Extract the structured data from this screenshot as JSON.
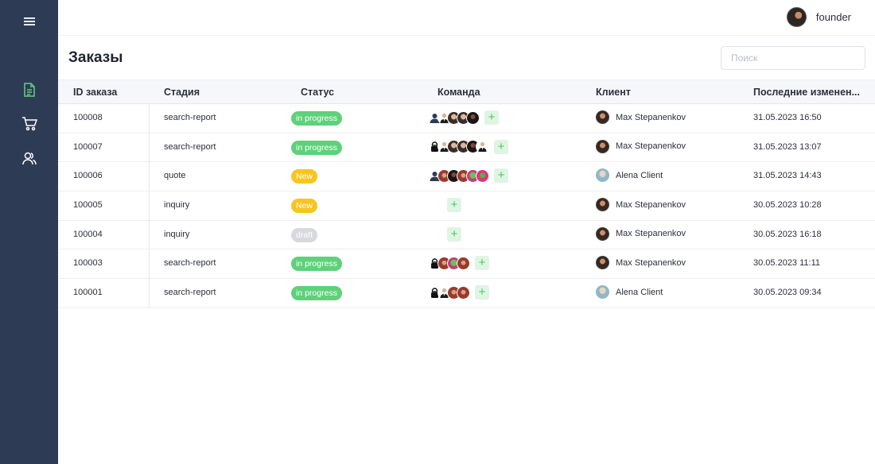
{
  "sidebar": {
    "items": [
      {
        "name": "menu",
        "icon": "hamburger-icon",
        "color": "#ffffff"
      },
      {
        "name": "orders",
        "icon": "document-icon",
        "color": "#5ed17a",
        "active": true
      },
      {
        "name": "cart",
        "icon": "cart-icon",
        "color": "#ffffff"
      },
      {
        "name": "users",
        "icon": "users-icon",
        "color": "#ffffff"
      }
    ]
  },
  "header": {
    "user_name": "founder"
  },
  "page": {
    "title": "Заказы",
    "search_placeholder": "Поиск"
  },
  "table": {
    "columns": [
      "ID заказа",
      "Стадия",
      "Статус",
      "Команда",
      "Клиент",
      "Последние изменен..."
    ],
    "add_label": "+",
    "rows": [
      {
        "id": "100008",
        "stage": "search-report",
        "status": "in progress",
        "status_color": "#5ed17a",
        "team": [
          "person-icon",
          "man-icon",
          "photo",
          "photo",
          "dark"
        ],
        "client": "Max Stepanenkov",
        "client_avatar": "max",
        "date": "31.05.2023 16:50"
      },
      {
        "id": "100007",
        "stage": "search-report",
        "status": "in progress",
        "status_color": "#5ed17a",
        "team": [
          "lock-person-icon",
          "man-icon",
          "photo",
          "photo",
          "dark",
          "man-icon"
        ],
        "client": "Max Stepanenkov",
        "client_avatar": "max",
        "date": "31.05.2023 13:07"
      },
      {
        "id": "100006",
        "stage": "quote",
        "status": "New",
        "status_color": "#f7c51e",
        "team": [
          "person-icon",
          "red",
          "dark",
          "red",
          "frog",
          "pink"
        ],
        "client": "Alena Client",
        "client_avatar": "alena",
        "date": "31.05.2023 14:43"
      },
      {
        "id": "100005",
        "stage": "inquiry",
        "status": "New",
        "status_color": "#f7c51e",
        "team": [],
        "client": "Max Stepanenkov",
        "client_avatar": "max",
        "date": "30.05.2023 10:28"
      },
      {
        "id": "100004",
        "stage": "inquiry",
        "status": "draft",
        "status_color": "#d7d9de",
        "team": [],
        "client": "Max Stepanenkov",
        "client_avatar": "max",
        "date": "30.05.2023 16:18"
      },
      {
        "id": "100003",
        "stage": "search-report",
        "status": "in progress",
        "status_color": "#5ed17a",
        "team": [
          "lock-person-icon",
          "red",
          "frog",
          "red"
        ],
        "client": "Max Stepanenkov",
        "client_avatar": "max",
        "date": "30.05.2023 11:11"
      },
      {
        "id": "100001",
        "stage": "search-report",
        "status": "in progress",
        "status_color": "#5ed17a",
        "team": [
          "lock-person-icon",
          "man-icon",
          "red",
          "red"
        ],
        "client": "Alena Client",
        "client_avatar": "alena",
        "date": "30.05.2023 09:34"
      }
    ]
  }
}
